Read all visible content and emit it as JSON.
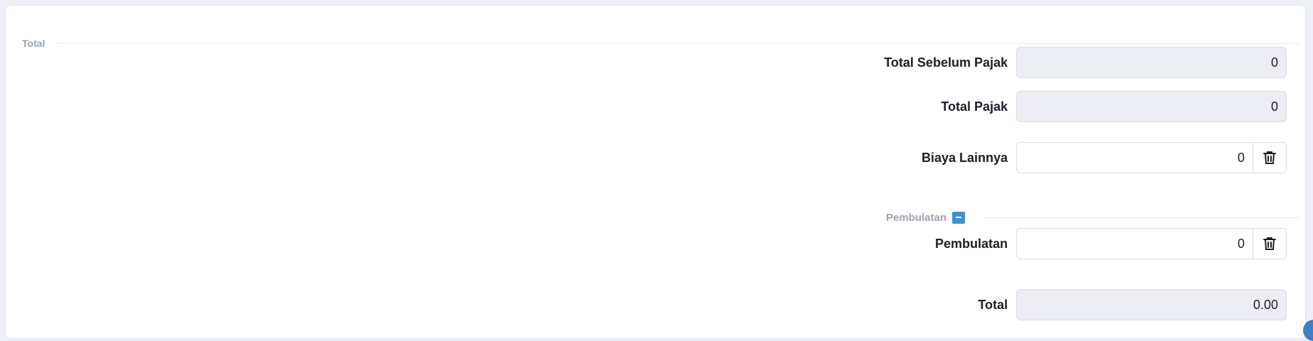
{
  "section": {
    "title": "Total"
  },
  "fields": {
    "subtotal": {
      "label": "Total Sebelum Pajak",
      "value": "0"
    },
    "tax": {
      "label": "Total Pajak",
      "value": "0"
    },
    "other_cost": {
      "label": "Biaya Lainnya",
      "value": "0"
    },
    "rounding": {
      "label": "Pembulatan",
      "value": "0"
    },
    "total": {
      "label": "Total",
      "value": "0.00"
    }
  },
  "rounding_section": {
    "title": "Pembulatan",
    "collapse_icon": "minus-icon"
  },
  "icons": {
    "delete": "trash-icon"
  },
  "colors": {
    "accent": "#3f93cf",
    "readonly_bg": "#eceef3",
    "muted_text": "#9aa3b8"
  }
}
